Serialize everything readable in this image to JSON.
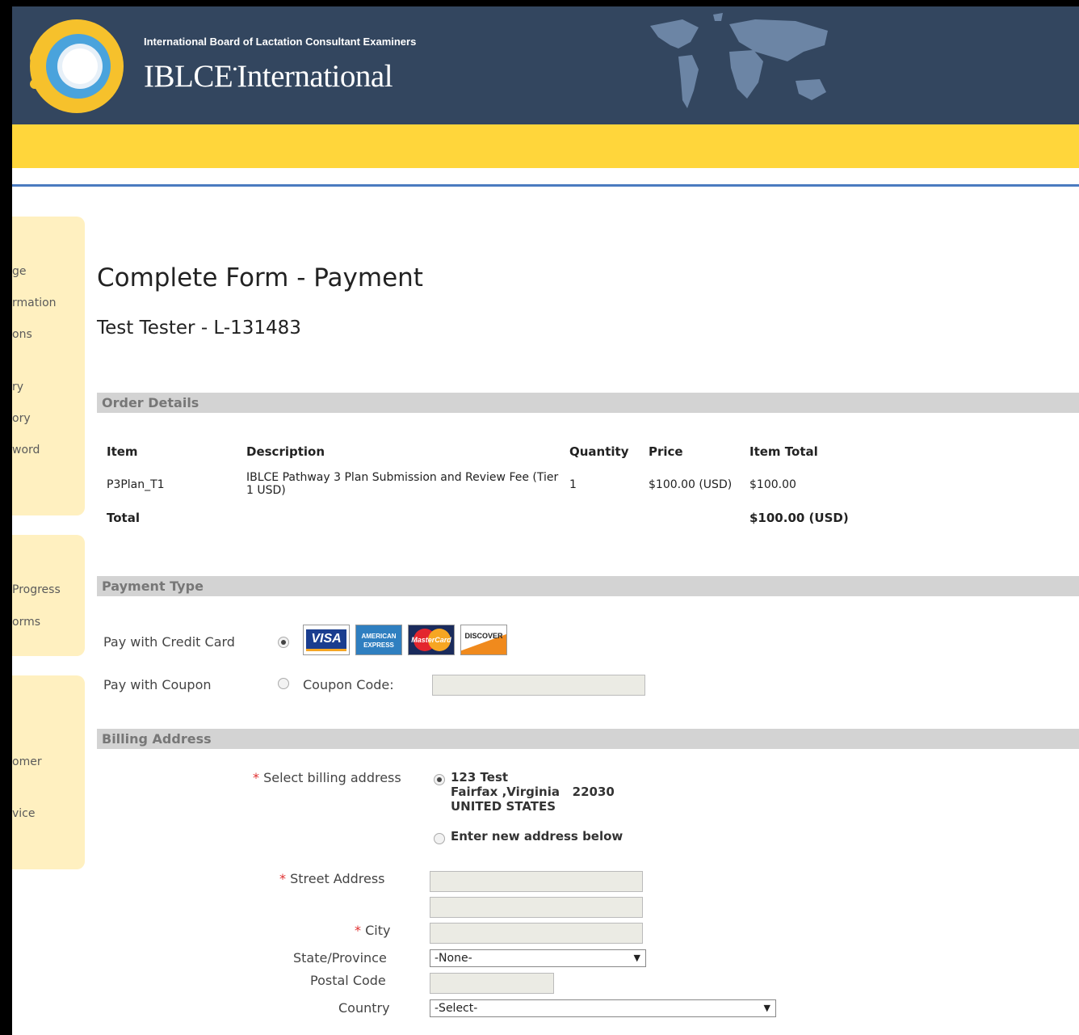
{
  "header": {
    "org_name": "International Board of Lactation Consultant Examiners",
    "brand_main": "IBLCE",
    "brand_suffix": "International"
  },
  "sidebar": {
    "items": [
      "ge",
      "rmation",
      "ons",
      "ry",
      "ory",
      "word",
      "Progress",
      "orms",
      "omer",
      "vice"
    ]
  },
  "page": {
    "title": "Complete Form - Payment",
    "applicant": "Test Tester - L-131483"
  },
  "order_details": {
    "section_title": "Order Details",
    "columns": [
      "Item",
      "Description",
      "Quantity",
      "Price",
      "Item Total"
    ],
    "rows": [
      {
        "item": "P3Plan_T1",
        "description": "IBLCE Pathway 3 Plan Submission and Review Fee (Tier 1 USD)",
        "quantity": "1",
        "price": "$100.00 (USD)",
        "item_total": "$100.00"
      }
    ],
    "total_label": "Total",
    "total_value": "$100.00 (USD)"
  },
  "payment_type": {
    "section_title": "Payment Type",
    "credit_card_label": "Pay with Credit Card",
    "credit_card_selected": true,
    "cards": [
      "VISA",
      "AMERICAN EXPRESS",
      "MasterCard",
      "DISCOVER"
    ],
    "coupon_label": "Pay with Coupon",
    "coupon_selected": false,
    "coupon_code_label": "Coupon Code:",
    "coupon_code_value": ""
  },
  "billing": {
    "section_title": "Billing Address",
    "select_label": "Select billing address",
    "saved_address": {
      "line1": "123 Test",
      "line2": "Fairfax ,Virginia   22030",
      "line3": "UNITED STATES",
      "selected": true
    },
    "new_address_label": "Enter new address below",
    "street_label": "Street Address",
    "city_label": "City",
    "state_label": "State/Province",
    "state_value": "-None-",
    "postal_label": "Postal Code",
    "country_label": "Country",
    "country_value": "-Select-",
    "required_mark": "*"
  },
  "colors": {
    "header_bg": "#33465f",
    "yellow_band": "#ffd63b",
    "sidebar_bg": "#fff0c0",
    "section_bar": "#d3d3d3",
    "accent_line": "#4a7bc0"
  }
}
